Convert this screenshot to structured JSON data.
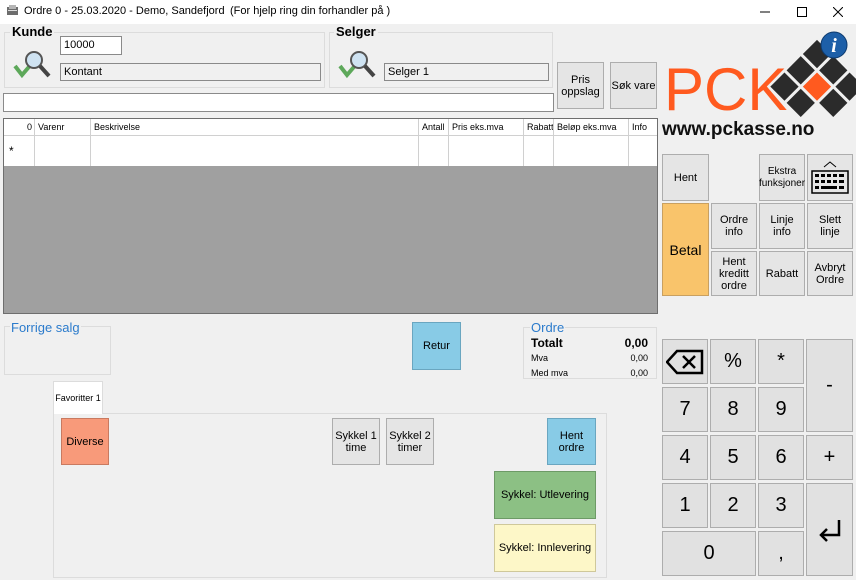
{
  "window": {
    "title": "Ordre 0 - 25.03.2020 - Demo, Sandefjord",
    "help_text": "(For hjelp ring din forhandler  på )"
  },
  "kunde": {
    "label": "Kunde",
    "number": "10000",
    "name": "Kontant"
  },
  "selger": {
    "label": "Selger",
    "name": "Selger 1"
  },
  "buttons": {
    "pris_oppslag": "Pris oppslag",
    "sok_vare": "Søk vare",
    "retur": "Retur",
    "hent": "Hent",
    "ekstra": "Ekstra funksjoner",
    "betal": "Betal",
    "ordre_info": "Ordre info",
    "linje_info": "Linje info",
    "slett_linje": "Slett linje",
    "hent_kreditt": "Hent kreditt ordre",
    "rabatt": "Rabatt",
    "avbryt": "Avbryt Ordre"
  },
  "logo": {
    "text": "PCK",
    "url": "www.pckasse.no"
  },
  "grid": {
    "columns": [
      "0",
      "Varenr",
      "Beskrivelse",
      "Antall",
      "Pris eks.mva",
      "Rabatt",
      "Beløp eks.mva",
      "Info"
    ],
    "new_row_marker": "*"
  },
  "forrige_salg": {
    "label": "Forrige salg"
  },
  "ordre": {
    "label": "Ordre",
    "totalt_label": "Totalt",
    "totalt_value": "0,00",
    "mva_label": "Mva",
    "mva_value": "0,00",
    "med_mva_label": "Med mva",
    "med_mva_value": "0,00"
  },
  "favorites": {
    "tab": "Favoritter 1",
    "diverse": "Diverse",
    "sykkel1": "Sykkel 1 time",
    "sykkel2": "Sykkel 2 timer",
    "hent_ordre": "Hent ordre",
    "utlevering": "Sykkel: Utlevering",
    "innlevering": "Sykkel: Innlevering"
  },
  "keypad": {
    "percent": "%",
    "star": "*",
    "minus": "-",
    "plus": "+",
    "k7": "7",
    "k8": "8",
    "k9": "9",
    "k4": "4",
    "k5": "5",
    "k6": "6",
    "k1": "1",
    "k2": "2",
    "k3": "3",
    "k0": "0",
    "comma": ","
  },
  "colors": {
    "betal": "#f9c46b",
    "retur": "#88cbe6",
    "diverse": "#f89a7a",
    "hent_ordre": "#88cbe6",
    "utlevering": "#8cc084",
    "innlevering": "#fdf7c8",
    "logo_orange": "#ff5a1f",
    "group_label_blue": "#2b7bcc"
  }
}
